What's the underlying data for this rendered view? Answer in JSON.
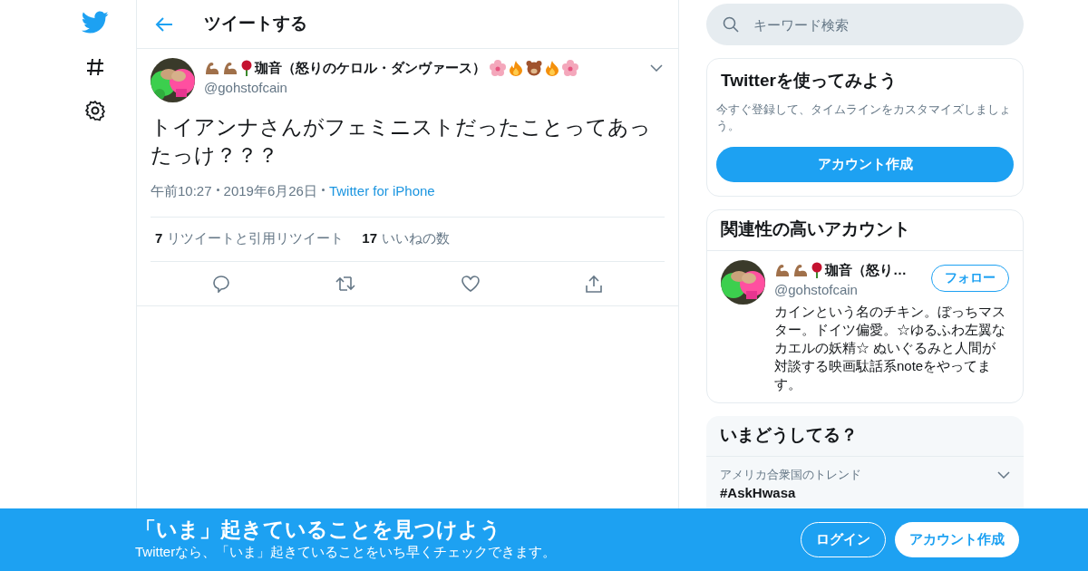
{
  "header": {
    "title": "ツイートする"
  },
  "tweet": {
    "display_name": "珈音（怒りのケロル・ダンヴァース）",
    "handle": "@gohstofcain",
    "text": "トイアンナさんがフェミニストだったことってあったっけ？？？",
    "time": "午前10:27",
    "date": "2019年6月26日",
    "source": "Twitter for iPhone",
    "retweet_count": "7",
    "retweet_label": "リツイートと引用リツイート",
    "like_count": "17",
    "like_label": "いいねの数"
  },
  "search": {
    "placeholder": "キーワード検索"
  },
  "signup_card": {
    "title": "Twitterを使ってみよう",
    "text": "今すぐ登録して、タイムラインをカスタマイズしましょう。",
    "button": "アカウント作成"
  },
  "related": {
    "title": "関連性の高いアカウント",
    "accounts": [
      {
        "name": "珈音（怒り…",
        "handle": "@gohstofcain",
        "bio": "カインという名のチキン。ぼっちマスター。ドイツ偏愛。☆ゆるふわ左翼なカエルの妖精☆ ぬいぐるみと人間が対談する映画駄話系noteをやってます。",
        "follow": "フォロー"
      }
    ]
  },
  "trends": {
    "title": "いまどうしてる？",
    "items": [
      {
        "context": "アメリカ合衆国のトレンド",
        "name": "#AskHwasa"
      }
    ]
  },
  "banner": {
    "title": "「いま」起きていることを見つけよう",
    "subtitle": "Twitterなら、「いま」起きていることをいち早くチェックできます。",
    "login": "ログイン",
    "signup": "アカウント作成"
  }
}
